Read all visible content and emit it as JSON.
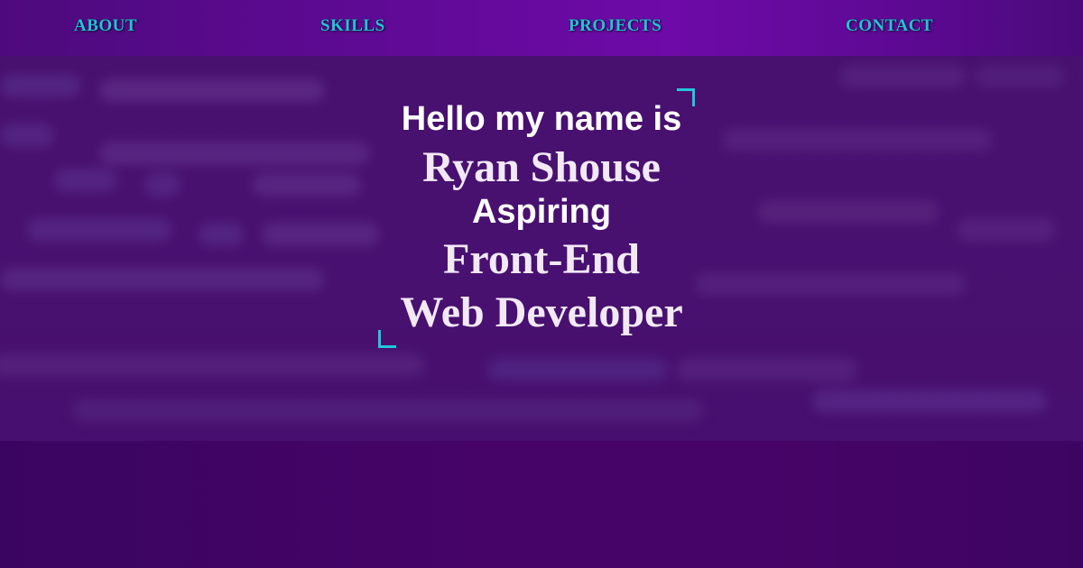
{
  "nav": {
    "items": [
      {
        "label": "ABOUT"
      },
      {
        "label": "SKILLS"
      },
      {
        "label": "PROJECTS"
      },
      {
        "label": "CONTACT"
      }
    ]
  },
  "hero": {
    "greeting": "Hello my name is",
    "name": "Ryan Shouse",
    "aspiring": "Aspiring",
    "role_line1": "Front-End",
    "role_line2": "Web Developer"
  },
  "colors": {
    "nav_link": "#20c4d8",
    "accent_corner": "#22c6dc",
    "background": "#440468",
    "navbar": "#6e0aa8"
  }
}
